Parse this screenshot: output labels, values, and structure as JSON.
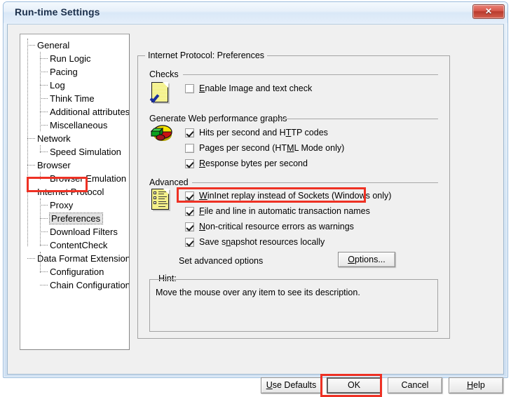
{
  "window": {
    "title": "Run-time Settings",
    "close_label": "✕"
  },
  "tree": {
    "items": [
      {
        "label": "General",
        "level": 0,
        "selected": false
      },
      {
        "label": "Run Logic",
        "level": 1,
        "selected": false
      },
      {
        "label": "Pacing",
        "level": 1,
        "selected": false
      },
      {
        "label": "Log",
        "level": 1,
        "selected": false
      },
      {
        "label": "Think Time",
        "level": 1,
        "selected": false
      },
      {
        "label": "Additional attributes",
        "level": 1,
        "selected": false
      },
      {
        "label": "Miscellaneous",
        "level": 1,
        "selected": false
      },
      {
        "label": "Network",
        "level": 0,
        "selected": false
      },
      {
        "label": "Speed Simulation",
        "level": 1,
        "selected": false
      },
      {
        "label": "Browser",
        "level": 0,
        "selected": false
      },
      {
        "label": "Browser Emulation",
        "level": 1,
        "selected": false
      },
      {
        "label": "Internet Protocol",
        "level": 0,
        "selected": false
      },
      {
        "label": "Proxy",
        "level": 1,
        "selected": false
      },
      {
        "label": "Preferences",
        "level": 1,
        "selected": true
      },
      {
        "label": "Download Filters",
        "level": 1,
        "selected": false
      },
      {
        "label": "ContentCheck",
        "level": 1,
        "selected": false
      },
      {
        "label": "Data Format Extension",
        "level": 0,
        "selected": false
      },
      {
        "label": "Configuration",
        "level": 1,
        "selected": false
      },
      {
        "label": "Chain Configuration",
        "level": 1,
        "selected": false
      }
    ]
  },
  "panel": {
    "title": "Internet Protocol: Preferences",
    "sections": {
      "checks": {
        "label": "Checks",
        "icon": "document-check-icon",
        "options": [
          {
            "label_pre": "",
            "accel": "E",
            "label_post": "nable Image and text check",
            "checked": false
          }
        ]
      },
      "graphs": {
        "label": "Generate Web performance graphs",
        "icon": "pie-chart-icon",
        "options": [
          {
            "label_pre": "Hits per second and H",
            "accel": "T",
            "label_post": "TP codes",
            "checked": true
          },
          {
            "label_pre": "Pages per second (HT",
            "accel": "M",
            "label_post": "L Mode only)",
            "checked": false
          },
          {
            "label_pre": "",
            "accel": "R",
            "label_post": "esponse bytes per second",
            "checked": true
          }
        ]
      },
      "advanced": {
        "label": "Advanced",
        "icon": "form-list-icon",
        "options": [
          {
            "label_pre": "",
            "accel": "W",
            "label_post": "inInet replay instead of Sockets (Windows only)",
            "checked": true
          },
          {
            "label_pre": "",
            "accel": "F",
            "label_post": "ile and line in automatic transaction names",
            "checked": true
          },
          {
            "label_pre": "",
            "accel": "N",
            "label_post": "on-critical resource errors as warnings",
            "checked": true
          },
          {
            "label_pre": "Save s",
            "accel": "n",
            "label_post": "apshot resources locally",
            "checked": true
          }
        ],
        "set_advanced_text": "Set advanced options",
        "options_button": {
          "pre": "",
          "accel": "O",
          "post": "ptions..."
        }
      }
    },
    "hint": {
      "legend": "Hint:",
      "text": "Move the mouse over any item to see its description."
    }
  },
  "footer": {
    "buttons": [
      {
        "pre": "",
        "accel": "U",
        "post": "se Defaults",
        "focused": false
      },
      {
        "pre": "OK",
        "accel": "",
        "post": "",
        "focused": true
      },
      {
        "pre": "Cancel",
        "accel": "",
        "post": "",
        "focused": false
      },
      {
        "pre": "",
        "accel": "H",
        "post": "elp",
        "focused": false
      }
    ]
  },
  "annotations": {
    "colors": {
      "highlight": "#ee3124"
    },
    "boxes": [
      {
        "name": "annotation-preferences"
      },
      {
        "name": "annotation-wininet"
      },
      {
        "name": "annotation-ok"
      }
    ]
  }
}
